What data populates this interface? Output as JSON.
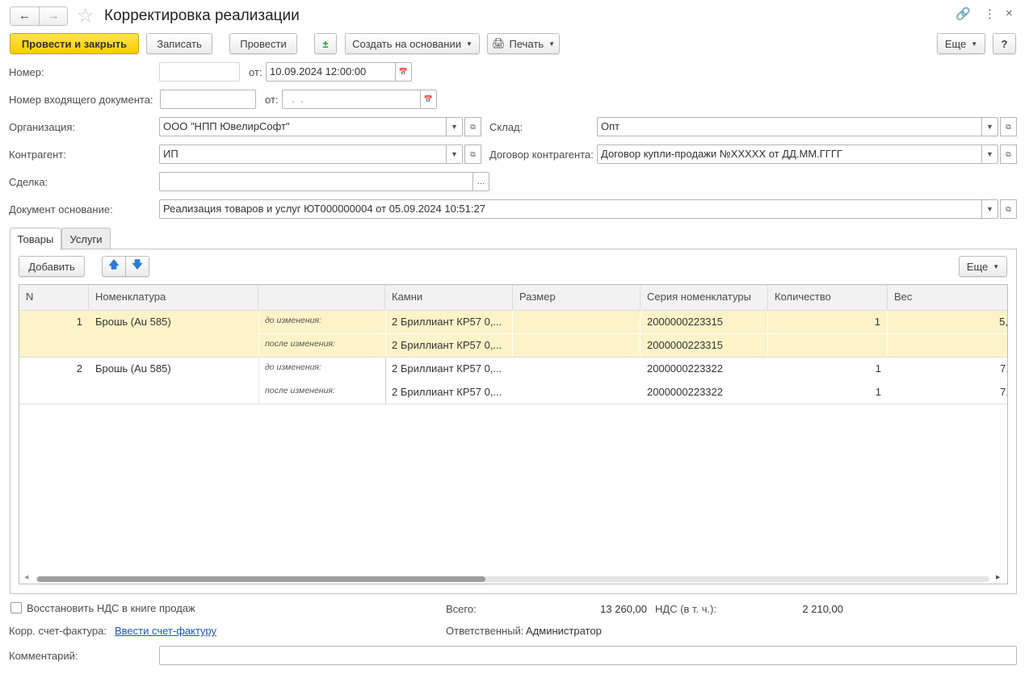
{
  "window": {
    "title": "Корректировка реализации"
  },
  "toolbar": {
    "post_close": "Провести и закрыть",
    "save": "Записать",
    "post": "Провести",
    "create_based": "Создать на основании",
    "print": "Печать",
    "more": "Еще",
    "help": "?"
  },
  "form": {
    "number_label": "Номер:",
    "number_value": "",
    "from_label": "от:",
    "date_value": "10.09.2024 12:00:00",
    "incoming_label": "Номер входящего документа:",
    "incoming_value": "",
    "incoming_from_label": "от:",
    "incoming_date_value": "  .  .",
    "org_label": "Организация:",
    "org_value": "ООО \"НПП ЮвелирСофт\"",
    "warehouse_label": "Склад:",
    "warehouse_value": "Опт",
    "counterparty_label": "Контрагент:",
    "counterparty_value": "ИП",
    "contract_label": "Договор контрагента:",
    "contract_value": "Договор купли-продажи №XXXXX от ДД.ММ.ГГГГ",
    "deal_label": "Сделка:",
    "deal_value": "",
    "deal_button": "...",
    "base_label": "Документ основание:",
    "base_value": "Реализация товаров и услуг ЮТ000000004 от 05.09.2024 10:51:27"
  },
  "tabs": [
    {
      "label": "Товары",
      "active": true
    },
    {
      "label": "Услуги",
      "active": false
    }
  ],
  "table_toolbar": {
    "add": "Добавить",
    "more": "Еще"
  },
  "table": {
    "columns": [
      "N",
      "Номенклатура",
      "",
      "Камни",
      "Размер",
      "Серия номенклатуры",
      "Количество",
      "Вес"
    ],
    "rows": [
      {
        "n": "1",
        "item": "Брошь (Au 585)",
        "selected": true,
        "before": {
          "label": "до изменения:",
          "stones": "2 Бриллиант КР57 0,...",
          "size": "",
          "series": "2000000223315",
          "qty": "1",
          "weight": "5,"
        },
        "after": {
          "label": "после изменения:",
          "stones": "2 Бриллиант КР57 0,...",
          "size": "",
          "series": "2000000223315",
          "qty": "",
          "weight": ""
        }
      },
      {
        "n": "2",
        "item": "Брошь (Au 585)",
        "selected": false,
        "before": {
          "label": "до изменения:",
          "stones": "2 Бриллиант КР57 0,...",
          "size": "",
          "series": "2000000223322",
          "qty": "1",
          "weight": "7,"
        },
        "after": {
          "label": "после изменения:",
          "stones": "2 Бриллиант КР57 0,...",
          "size": "",
          "series": "2000000223322",
          "qty": "1",
          "weight": "7,"
        }
      }
    ]
  },
  "footer": {
    "restore_vat": "Восстановить НДС в книге продаж",
    "restore_vat_checked": false,
    "total_label": "Всего:",
    "total_value": "13 260,00",
    "vat_label": "НДС (в т. ч.):",
    "vat_value": "2 210,00",
    "invoice_label": "Корр. счет-фактура:",
    "invoice_link": "Ввести счет-фактуру",
    "responsible_label": "Ответственный:",
    "responsible_value": "Администратор",
    "comment_label": "Комментарий:",
    "comment_value": ""
  },
  "colors": {
    "primary": "#f5cf00",
    "selected_row": "#fdf3c8",
    "link": "#1a57b5"
  }
}
